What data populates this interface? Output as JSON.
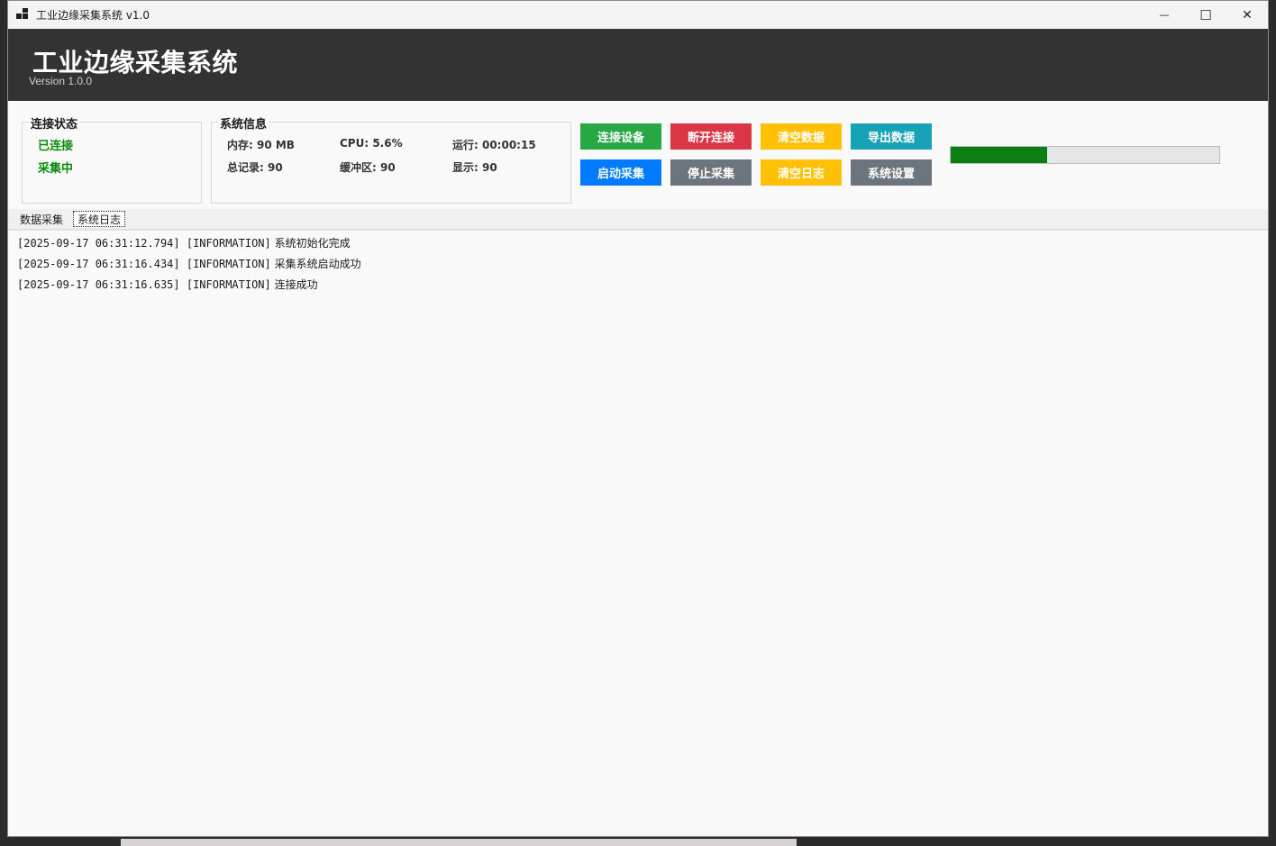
{
  "window": {
    "title": "工业边缘采集系统 v1.0",
    "controls": {
      "minimize": "—",
      "maximize": "☐",
      "close": "✕"
    }
  },
  "header": {
    "title": "工业边缘采集系统",
    "version": "Version 1.0.0",
    "background": "#333333"
  },
  "connection_status": {
    "legend": "连接状态",
    "lines": [
      "已连接",
      "采集中"
    ],
    "color": "#0a8a0a"
  },
  "system_info": {
    "legend": "系统信息",
    "memory": "内存: 90 MB",
    "cpu": "CPU: 5.6%",
    "uptime": "运行: 00:00:15",
    "total_records": "总记录: 90",
    "buffer": "缓冲区: 90",
    "display": "显示: 90"
  },
  "buttons": {
    "connect": {
      "label": "连接设备",
      "color": "#28a745"
    },
    "disconnect": {
      "label": "断开连接",
      "color": "#dc3545"
    },
    "clear_data": {
      "label": "清空数据",
      "color": "#ffc107"
    },
    "export_data": {
      "label": "导出数据",
      "color": "#17a2b8"
    },
    "start": {
      "label": "启动采集",
      "color": "#007bff"
    },
    "stop": {
      "label": "停止采集",
      "color": "#6c757d"
    },
    "clear_log": {
      "label": "清空日志",
      "color": "#ffc107"
    },
    "settings": {
      "label": "系统设置",
      "color": "#6c757d"
    }
  },
  "progress": {
    "value": 0.36,
    "color": "#0b7f14"
  },
  "tabs": [
    {
      "label": "数据采集",
      "selected": false
    },
    {
      "label": "系统日志",
      "selected": true
    }
  ],
  "log": [
    {
      "prefix": "[2025-09-17 06:31:12.794] [INFORMATION]",
      "message": "系统初始化完成"
    },
    {
      "prefix": "[2025-09-17 06:31:16.434] [INFORMATION]",
      "message": "采集系统启动成功"
    },
    {
      "prefix": "[2025-09-17 06:31:16.635] [INFORMATION]",
      "message": "连接成功"
    }
  ]
}
